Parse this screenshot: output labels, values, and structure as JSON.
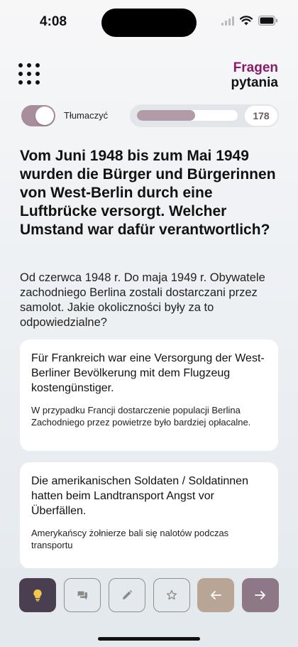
{
  "status": {
    "time": "4:08"
  },
  "header": {
    "brand_top": "Fragen",
    "brand_bottom": "pytania",
    "menu_icon": "grid-dots-icon"
  },
  "translate_toggle": {
    "label": "Tłumaczyć",
    "on": true
  },
  "progress": {
    "fraction": 0.58,
    "count": "178"
  },
  "question": {
    "de": "Vom Juni 1948 bis zum Mai 1949 wurden die Bürger und Bürgerinnen von West-Berlin durch eine Luftbrücke versorgt. Welcher Umstand war dafür verantwortlich?",
    "pl": "Od czerwca 1948 r. Do maja 1949 r. Obywatele zachodniego Berlina zostali dostarczani przez samolot. Jakie okoliczności były za to odpowiedzialne?"
  },
  "answers": [
    {
      "de": "Für Frankreich war eine Versorgung der West-Berliner Bevölkerung mit dem Flugzeug kostengünstiger.",
      "pl": "W przypadku Francji dostarczenie populacji Berlina Zachodniego przez powietrze było bardziej opłacalne."
    },
    {
      "de": "Die amerikanischen Soldaten / Soldatinnen hatten beim Landtransport Angst vor Überfällen.",
      "pl": "Amerykańscy żołnierze bali się nalotów podczas transportu"
    }
  ],
  "toolbar": {
    "icons": [
      "lightbulb-icon",
      "comment-icon",
      "pencil-icon",
      "star-icon",
      "arrow-left-icon",
      "arrow-right-icon"
    ]
  },
  "colors": {
    "brand": "#8b1a6b",
    "toggle": "#a88e9d",
    "progress": "#b29aa9",
    "hint_button": "#4a3f51",
    "prev_button": "#b9a596",
    "next_button": "#8e7786"
  }
}
